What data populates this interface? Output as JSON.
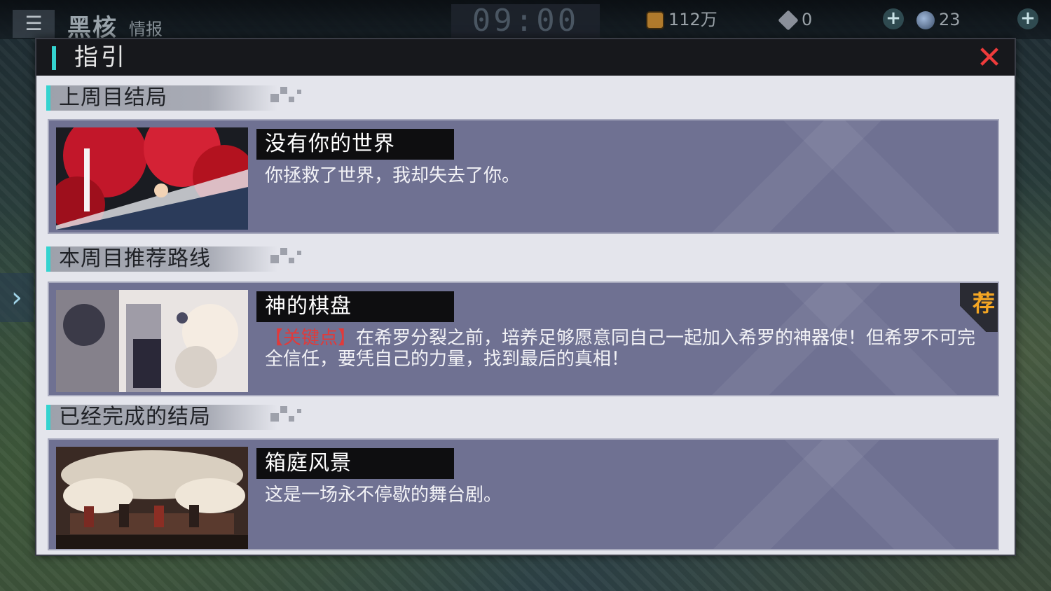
{
  "topbar": {
    "brand_main": "黑核",
    "brand_sub": "情报",
    "clock": "09:00",
    "gold": "112万",
    "gems": "0",
    "orbs": "23"
  },
  "dialog": {
    "title": "指引",
    "close_symbol": "✕",
    "sections": [
      {
        "label": "上周目结局",
        "card": {
          "name": "没有你的世界",
          "desc": "你拯救了世界，我却失去了你。"
        }
      },
      {
        "label": "本周目推荐路线",
        "card": {
          "name": "神的棋盘",
          "key_label": "【关键点】",
          "desc": "在希罗分裂之前，培养足够愿意同自己一起加入希罗的神器使！但希罗不可完全信任，要凭自己的力量，找到最后的真相！",
          "badge": "荐"
        }
      },
      {
        "label": "已经完成的结局",
        "card": {
          "name": "箱庭风景",
          "desc": "这是一场永不停歇的舞台剧。"
        }
      }
    ]
  },
  "colors": {
    "accent": "#34d3cf",
    "close": "#ef3b3b",
    "key_point": "#e13a3a",
    "badge": "#f5a623",
    "card_bg": "#6f7192"
  }
}
